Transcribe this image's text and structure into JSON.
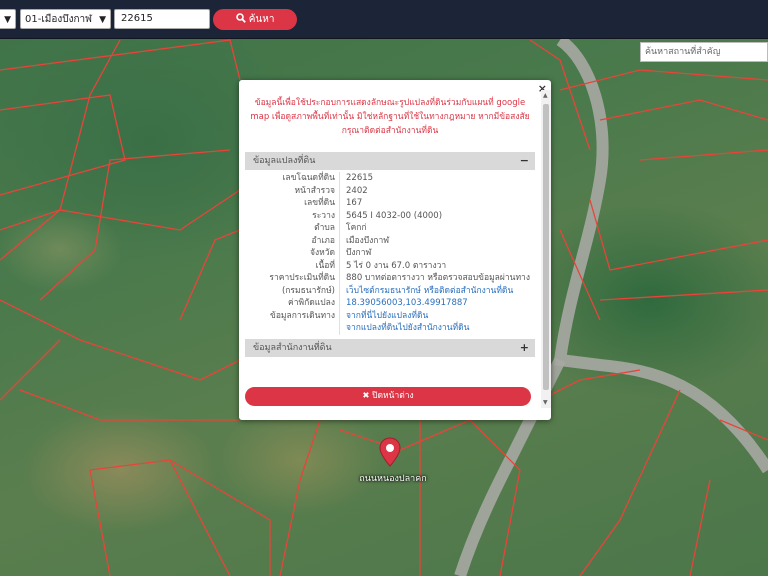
{
  "topbar": {
    "district_select": "01-เมืองบึงกาฬ",
    "parcel_number": "22615",
    "search_label": "ค้นหา"
  },
  "place_search": {
    "placeholder": "ค้นหาสถานที่สำคัญ"
  },
  "popup": {
    "disclaimer": "ข้อมูลนี้เพื่อใช้ประกอบการแสดงลักษณะรูปแปลงที่ดินร่วมกับแผนที่ google map เพื่อดูสภาพพื้นที่เท่านั้น มิใช่หลักฐานที่ใช้ในทางกฎหมาย หากมีข้อสงสัยกรุณาติดต่อสำนักงานที่ดิน",
    "section_parcel": {
      "title": "ข้อมูลแปลงที่ดิน",
      "toggle": "−"
    },
    "rows": [
      {
        "label": "เลขโฉนดที่ดิน",
        "value": "22615"
      },
      {
        "label": "หน้าสำรวจ",
        "value": "2402"
      },
      {
        "label": "เลขที่ดิน",
        "value": "167"
      },
      {
        "label": "ระวาง",
        "value": "5645 I 4032-00 (4000)"
      },
      {
        "label": "ตำบล",
        "value": "โคกก่"
      },
      {
        "label": "อำเภอ",
        "value": "เมืองบึงกาฬ"
      },
      {
        "label": "จังหวัด",
        "value": "บึงกาฬ"
      },
      {
        "label": "เนื้อที่",
        "value": "5 ไร่ 0 งาน 67.0 ตารางวา"
      }
    ],
    "price": {
      "label": "ราคาประเมินที่ดิน",
      "label2": "(กรมธนารักษ์)",
      "value": "880 บาทต่อตารางวา หรือตรวจสอบข้อมูลผ่านทาง",
      "value2": "เว็บไซต์กรมธนารักษ์ หรือติดต่อสำนักงานที่ดิน"
    },
    "coords": {
      "label": "ค่าพิกัดแปลง",
      "value": "18.39056003,103.49917887"
    },
    "travel": {
      "label": "ข้อมูลการเดินทาง",
      "value": "จากที่นี่ไปยังแปลงที่ดิน",
      "value2": "จากแปลงที่ดินไปยังสำนักงานที่ดิน"
    },
    "section_office": {
      "title": "ข้อมูลสำนักงานที่ดิน",
      "toggle": "+"
    },
    "close_label": "✖ ปิดหน้าต่าง",
    "close_x": "×"
  },
  "marker": {
    "label": "ถนนหนองปลาคก"
  },
  "colors": {
    "accent": "#dc3545",
    "topbar": "#1c2538",
    "parcel_lines": "#e8443a"
  }
}
